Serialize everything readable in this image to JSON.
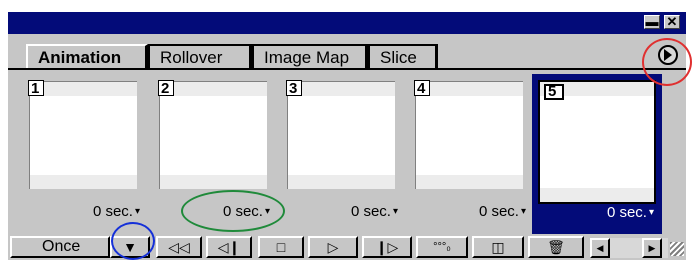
{
  "tabs": [
    {
      "label": "Animation",
      "active": true
    },
    {
      "label": "Rollover",
      "active": false
    },
    {
      "label": "Image Map",
      "active": false
    },
    {
      "label": "Slice",
      "active": false
    }
  ],
  "frames": [
    {
      "number": "1",
      "delay": "0 sec."
    },
    {
      "number": "2",
      "delay": "0 sec."
    },
    {
      "number": "3",
      "delay": "0 sec."
    },
    {
      "number": "4",
      "delay": "0 sec."
    },
    {
      "number": "5",
      "delay": "0 sec.",
      "selected": true
    }
  ],
  "loop": {
    "value": "Once"
  },
  "colors": {
    "titlebar": "#030b79",
    "panel": "#c6c6c6",
    "annotation_red": "#e03030",
    "annotation_green": "#1f8a3a",
    "annotation_blue": "#1530d8"
  }
}
